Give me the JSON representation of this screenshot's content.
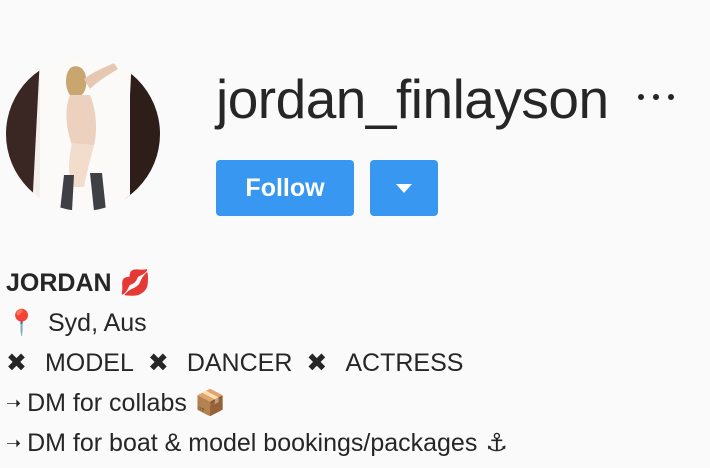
{
  "profile": {
    "username": "jordan_finlayson",
    "more_icon": "more-horizontal-icon",
    "follow_label": "Follow",
    "dropdown_icon": "caret-down-icon",
    "accent_color": "#3897f0",
    "avatar_alt": "profile picture"
  },
  "bio": {
    "name": "JORDAN",
    "name_emoji": "💋",
    "location_emoji": "📍",
    "location": "Syd, Aus",
    "x_symbol": "✖",
    "roles": [
      "MODEL",
      "DANCER",
      "ACTRESS"
    ],
    "arrow": "➝",
    "line4_text": "DM for collabs",
    "line4_emoji": "📦",
    "line5_text": "DM for boat & model bookings/packages",
    "line5_emoji": "⚓"
  }
}
